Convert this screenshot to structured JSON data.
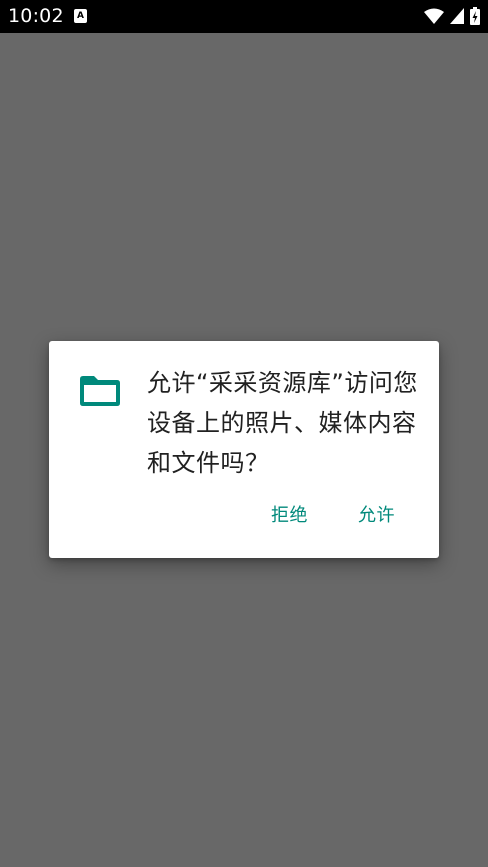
{
  "status_bar": {
    "time": "10:02",
    "notification_icon": "A",
    "icons": [
      "wifi-icon",
      "cellular-signal-icon",
      "battery-charging-icon"
    ]
  },
  "dialog": {
    "icon": "folder-icon",
    "message": "允许“采采资源库”访问您设备上的照片、媒体内容和文件吗？",
    "deny_label": "拒绝",
    "allow_label": "允许"
  },
  "colors": {
    "scrim": "#686868",
    "accent": "#00897b",
    "status_bar": "#000000",
    "dialog_bg": "#ffffff"
  }
}
